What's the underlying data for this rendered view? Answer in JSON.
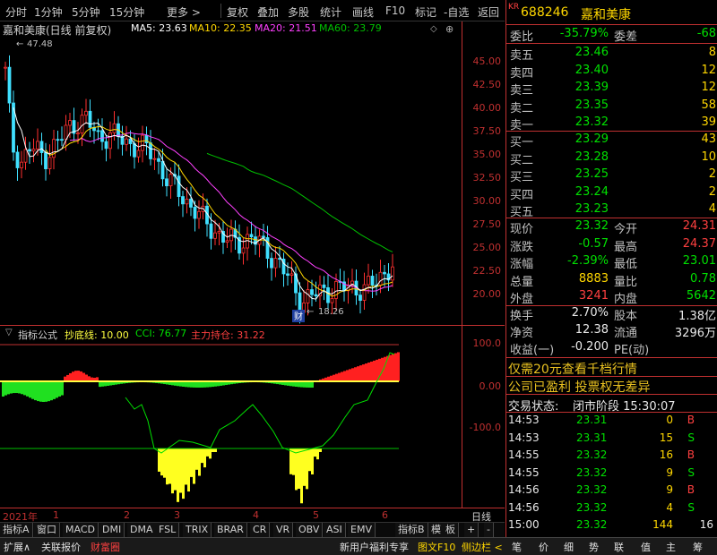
{
  "toolbar": {
    "items": [
      "分时",
      "1分钟",
      "5分钟",
      "15分钟",
      "更多 >",
      "复权",
      "叠加",
      "多股",
      "统计",
      "画线",
      "F10",
      "标记",
      "-自选",
      "返回"
    ]
  },
  "chart": {
    "title": "嘉和美康(日线 前复权)",
    "ma5": "MA5: 23.63",
    "ma10": "MA10: 22.35",
    "ma20": "MA20: 21.51",
    "ma60": "MA60: 23.79",
    "max_label": "47.48",
    "min_label": "18.26",
    "caiflag": "财",
    "price_ticks": [
      "45.00",
      "42.50",
      "40.00",
      "37.50",
      "35.00",
      "32.50",
      "30.00",
      "27.50",
      "25.00",
      "22.50",
      "20.00"
    ],
    "colors": {
      "ma5": "#ffffff",
      "ma10": "#ffd700",
      "ma20": "#ff40ff",
      "ma60": "#00c000",
      "up": "#ff3030",
      "down": "#40e0ff"
    }
  },
  "indicator": {
    "formula_label": "指标公式",
    "bottom_line": "抄底线: 10.00",
    "cci": "CCI: 76.77",
    "main_holding": "主力持仓: 31.22",
    "ticks": [
      "100.0",
      "0.00",
      "-100.0"
    ]
  },
  "dates": {
    "year": "2021年",
    "months": [
      "1",
      "2",
      "3",
      "4",
      "5",
      "6"
    ],
    "right": "日线"
  },
  "tabs": [
    "指标A",
    "窗口",
    "MACD",
    "DMI",
    "DMA",
    "FSL",
    "TRIX",
    "BRAR",
    "CR",
    "VR",
    "OBV",
    "ASI",
    "EMV",
    "指标B",
    "模",
    "板",
    "+",
    "-"
  ],
  "bottom": [
    "扩展∧",
    "关联报价",
    "财富圈",
    "新用户福利专享",
    "图文F10",
    "侧边栏 <",
    "笔",
    "价",
    "细",
    "势",
    "联",
    "值",
    "主",
    "筹"
  ],
  "quote": {
    "badge": "KR",
    "code": "688246",
    "name": "嘉和美康",
    "weibi_label": "委比",
    "weibi": "-35.79%",
    "weicha_label": "委差",
    "weicha": "-68",
    "sells": [
      {
        "label": "卖五",
        "price": "23.46",
        "vol": "8"
      },
      {
        "label": "卖四",
        "price": "23.40",
        "vol": "12"
      },
      {
        "label": "卖三",
        "price": "23.39",
        "vol": "12"
      },
      {
        "label": "卖二",
        "price": "23.35",
        "vol": "58"
      },
      {
        "label": "卖一",
        "price": "23.32",
        "vol": "39"
      }
    ],
    "buys": [
      {
        "label": "买一",
        "price": "23.29",
        "vol": "43"
      },
      {
        "label": "买二",
        "price": "23.28",
        "vol": "10"
      },
      {
        "label": "买三",
        "price": "23.25",
        "vol": "2"
      },
      {
        "label": "买四",
        "price": "23.24",
        "vol": "2"
      },
      {
        "label": "买五",
        "price": "23.23",
        "vol": "4"
      }
    ],
    "stats": [
      {
        "l1": "现价",
        "v1": "23.32",
        "c1": "green",
        "l2": "今开",
        "v2": "24.31",
        "c2": "red"
      },
      {
        "l1": "涨跌",
        "v1": "-0.57",
        "c1": "green",
        "l2": "最高",
        "v2": "24.37",
        "c2": "red"
      },
      {
        "l1": "涨幅",
        "v1": "-2.39%",
        "c1": "green",
        "l2": "最低",
        "v2": "23.01",
        "c2": "green"
      },
      {
        "l1": "总量",
        "v1": "8883",
        "c1": "yellow",
        "l2": "量比",
        "v2": "0.78",
        "c2": "green"
      },
      {
        "l1": "外盘",
        "v1": "3241",
        "c1": "red",
        "l2": "内盘",
        "v2": "5642",
        "c2": "green"
      }
    ],
    "stats2": [
      {
        "l1": "换手",
        "v1": "2.70%",
        "l2": "股本",
        "v2": "1.38亿"
      },
      {
        "l1": "净资",
        "v1": "12.38",
        "l2": "流通",
        "v2": "3296万"
      },
      {
        "l1": "收益(一)",
        "v1": "-0.200",
        "l2": "PE(动)",
        "v2": ""
      }
    ],
    "promo1": "仅需20元查看千档行情",
    "promo2": "公司已盈利 投票权无差异",
    "status_label": "交易状态:",
    "status": "闭市阶段 15:30:07",
    "ticks": [
      {
        "t": "14:53",
        "p": "23.31",
        "v": "0",
        "s": "B"
      },
      {
        "t": "14:53",
        "p": "23.31",
        "v": "15",
        "s": "S"
      },
      {
        "t": "14:55",
        "p": "23.32",
        "v": "16",
        "s": "B"
      },
      {
        "t": "14:55",
        "p": "23.32",
        "v": "9",
        "s": "S"
      },
      {
        "t": "14:56",
        "p": "23.32",
        "v": "9",
        "s": "B"
      },
      {
        "t": "14:56",
        "p": "23.32",
        "v": "4",
        "s": "S"
      },
      {
        "t": "15:00",
        "p": "23.32",
        "v": "144",
        "s": ""
      }
    ],
    "last_right": "16"
  }
}
